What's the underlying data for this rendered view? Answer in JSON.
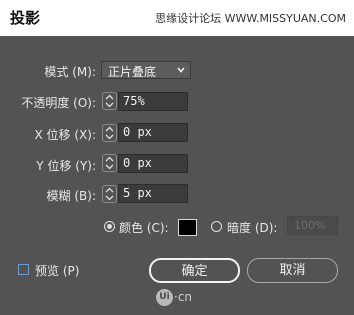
{
  "dialog": {
    "title": "投影",
    "watermark": "思缘设计论坛 WWW.MISSYUAN.COM"
  },
  "fields": {
    "mode_label": "模式 (M):",
    "mode_value": "正片叠底",
    "opacity_label": "不透明度 (O):",
    "opacity_value": "75%",
    "x_label": "X 位移 (X):",
    "x_value": "0 px",
    "y_label": "Y 位移 (Y):",
    "y_value": "0 px",
    "blur_label": "模糊 (B):",
    "blur_value": "5 px"
  },
  "color_options": {
    "color_label": "颜色 (C):",
    "darkness_label": "暗度 (D):",
    "darkness_value": "100%",
    "selected": "color",
    "swatch_color": "#000000"
  },
  "preview": {
    "label": "预览 (P)",
    "checked": false
  },
  "buttons": {
    "ok": "确定",
    "cancel": "取消"
  },
  "footer_logo": {
    "mark": "Ui",
    "suffix": "·cn"
  },
  "icons": {
    "mode_dropdown": "chevron-down-icon",
    "stepper": "up-down-arrows-icon"
  }
}
